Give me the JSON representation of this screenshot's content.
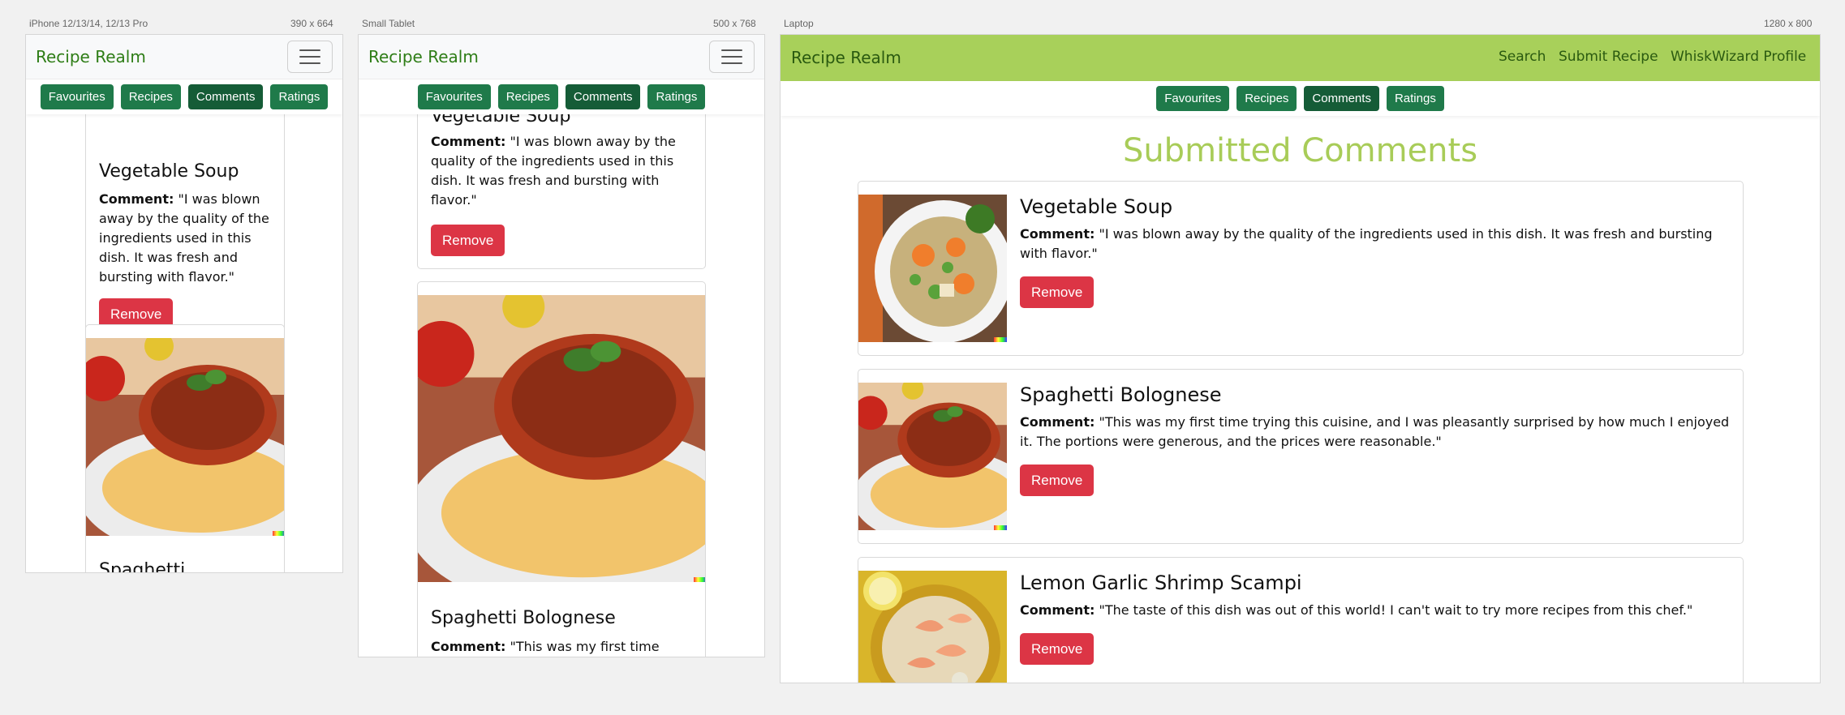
{
  "frames": {
    "phone": {
      "label": "iPhone 12/13/14, 12/13 Pro",
      "size": "390 x 664"
    },
    "tablet": {
      "label": "Small Tablet",
      "size": "500 x 768"
    },
    "laptop": {
      "label": "Laptop",
      "size": "1280 x 800"
    }
  },
  "brand": "Recipe Realm",
  "tabs": [
    "Favourites",
    "Recipes",
    "Comments",
    "Ratings"
  ],
  "active_tab": "Comments",
  "laptop_nav": [
    "Search",
    "Submit Recipe",
    "WhiskWizard Profile"
  ],
  "page_title": "Submitted Comments",
  "comment_label": "Comment:",
  "remove_label": "Remove",
  "comments": [
    {
      "title": "Vegetable Soup",
      "text": " \"I was blown away by the quality of the ingredients used in this dish. It was fresh and bursting with flavor.\""
    },
    {
      "title": "Spaghetti Bolognese",
      "text": " \"This was my first time trying this cuisine, and I was pleasantly surprised by how much I enjoyed it. The portions were generous, and the prices were reasonable.\""
    },
    {
      "title": "Lemon Garlic Shrimp Scampi",
      "text": " \"The taste of this dish was out of this world! I can't wait to try more recipes from this chef.\""
    }
  ],
  "phone_partial": {
    "title": "Spaghetti"
  },
  "tablet_partial": {
    "comment_start": " \"This was my first time"
  },
  "colors": {
    "brand_green": "#a8d05a",
    "tab_green": "#1f7a4a",
    "remove_red": "#dc3545",
    "title_green": "#a8cc58"
  }
}
